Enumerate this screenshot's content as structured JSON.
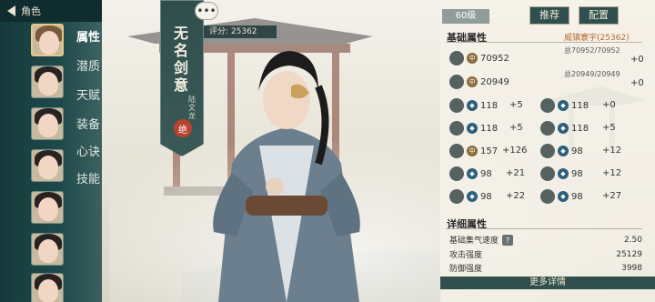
{
  "top_bar": {
    "title": "角色"
  },
  "tabs": [
    "属性",
    "潜质",
    "天赋",
    "装备",
    "心诀",
    "技能"
  ],
  "character": {
    "name": "无名剑意",
    "subtitle": "陆文龙",
    "seal": "绝",
    "score": "评分: 25362",
    "bubble": "•••"
  },
  "panel": {
    "level": "60级",
    "recommend_btn": "推荐",
    "config_btn": "配置",
    "basic_title": "基础属性",
    "owner": "威镇寰宇(25362)",
    "total1": "总70952/70952",
    "total2": "总20949/20949",
    "row1_value": "70952",
    "row1_bonus": "+0",
    "row2_value": "20949",
    "row2_bonus": "+0",
    "grid": [
      {
        "val": "118",
        "bonus": "+5",
        "val2": "118",
        "bonus2": "+0"
      },
      {
        "val": "118",
        "bonus": "+5",
        "val2": "118",
        "bonus2": "+5"
      },
      {
        "val": "157",
        "bonus": "+126",
        "val2": "98",
        "bonus2": "+12"
      },
      {
        "val": "98",
        "bonus": "+21",
        "val2": "98",
        "bonus2": "+12"
      },
      {
        "val": "98",
        "bonus": "+22",
        "val2": "98",
        "bonus2": "+27"
      }
    ],
    "detail_title": "详细属性",
    "details": [
      {
        "label": "基础集气速度",
        "value": "2.50"
      },
      {
        "label": "攻击强度",
        "value": "25129"
      },
      {
        "label": "防御强度",
        "value": "3998"
      }
    ],
    "more": "更多详情"
  },
  "colors": {
    "panel_dark": "#1f4a4b",
    "accent_gold": "#e7c98a",
    "owner_orange": "#b56b2e"
  }
}
